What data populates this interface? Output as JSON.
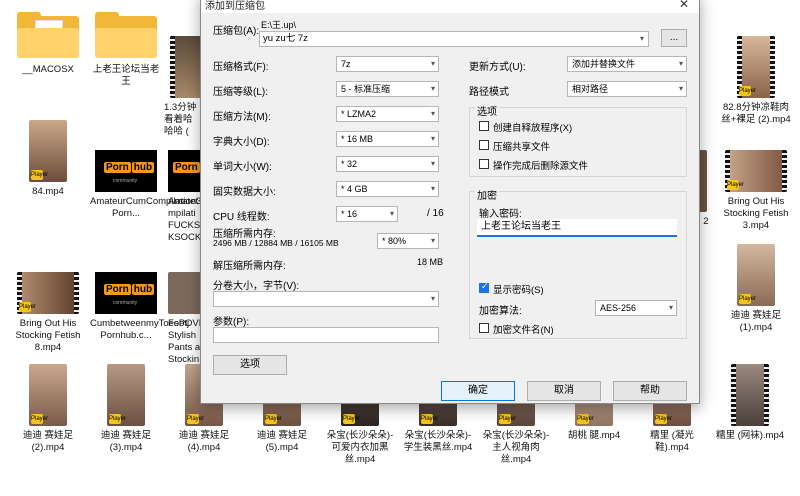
{
  "desktop": {
    "row1": [
      {
        "kind": "folder",
        "label": "__MACOSX"
      },
      {
        "kind": "folder",
        "label": "上老王论坛当老王"
      },
      {
        "kind": "video",
        "label": "1.3分钟 看着哈 哈哈 ("
      },
      {
        "kind": "video",
        "label": "82.8分钟凉鞋肉丝+裸足 (2).mp4"
      }
    ],
    "row2": [
      {
        "kind": "video",
        "label": "84.mp4"
      },
      {
        "kind": "pornhub",
        "label": "AmateurCumCompilation3MILFFEETSOCKSANDMORE-Porn..."
      },
      {
        "kind": "pornhub",
        "label": "Amatet mpilati FUCKS KSOCK"
      },
      {
        "kind": "video",
        "label": "All 2"
      },
      {
        "kind": "video",
        "label": "Bring Out His Stocking Fetish 3.mp4"
      }
    ],
    "row3": [
      {
        "kind": "video",
        "label": "Bring Out His Stocking Fetish 8.mp4"
      },
      {
        "kind": "pornhub",
        "label": "CumbetweenmyToesPOVFootjobAMATEURPORN-Pornhub.c..."
      },
      {
        "kind": "video",
        "label": "Footj Stylish Pants a Stockin"
      },
      {
        "kind": "video",
        "label": "迪迪 赛娃足 (1).mp4"
      }
    ],
    "row4": [
      {
        "kind": "video",
        "label": "迪迪 赛娃足 (2).mp4"
      },
      {
        "kind": "video",
        "label": "迪迪 赛娃足 (3).mp4"
      },
      {
        "kind": "video",
        "label": "迪迪 赛娃足 (4).mp4"
      },
      {
        "kind": "video",
        "label": "迪迪 赛娃足 (5).mp4"
      },
      {
        "kind": "video",
        "label": "朵宝(长沙朵朵)-可爱内衣加黑丝.mp4"
      },
      {
        "kind": "video",
        "label": "朵宝(长沙朵朵)-学生装黑丝.mp4"
      },
      {
        "kind": "video",
        "label": "朵宝(长沙朵朵)-主人视角肉丝.mp4"
      },
      {
        "kind": "video",
        "label": "胡桃 腿.mp4"
      },
      {
        "kind": "video",
        "label": "糯里 (凝光鞋).mp4"
      },
      {
        "kind": "video",
        "label": "糯里 (网袜).mp4"
      }
    ],
    "pornhub": {
      "logo_a": "Porn",
      "logo_b": "hub",
      "sub": "community"
    },
    "badge": "Player"
  },
  "dialog": {
    "title": "添加到压缩包",
    "archive_label": "压缩包(A):",
    "archive_path": "E:\\王.up\\",
    "archive_name": "yu zu七 7z",
    "browse_label": "...",
    "format_label": "压缩格式(F):",
    "format_value": "7z",
    "level_label": "压缩等级(L):",
    "level_value": "5 - 标准压缩",
    "method_label": "压缩方法(M):",
    "method_value": "* LZMA2",
    "dict_label": "字典大小(D):",
    "dict_value": "* 16 MB",
    "word_label": "单词大小(W):",
    "word_value": "* 32",
    "solid_label": "固实数据大小:",
    "solid_value": "* 4 GB",
    "threads_label": "CPU 线程数:",
    "threads_value": "* 16",
    "threads_max": "/ 16",
    "mem_label": "压缩所需内存:",
    "mem_value": "2496 MB / 12884 MB / 16105 MB",
    "mem_pct": "* 80%",
    "demem_label": "解压缩所需内存:",
    "demem_value": "18 MB",
    "split_label": "分卷大小，字节(V):",
    "params_label": "参数(P):",
    "options_btn": "选项",
    "update_label": "更新方式(U):",
    "update_value": "添加并替换文件",
    "path_label": "路径模式",
    "path_value": "相对路径",
    "opts_title": "选项",
    "opt_sfx": "创建自释放程序(X)",
    "opt_shared": "压缩共享文件",
    "opt_delete": "操作完成后删除源文件",
    "enc_title": "加密",
    "pwd_label": "输入密码:",
    "pwd_value": "上老王论坛当老王",
    "show_pwd": "显示密码(S)",
    "enc_method_label": "加密算法:",
    "enc_method_value": "AES-256",
    "enc_names": "加密文件名(N)",
    "ok": "确定",
    "cancel": "取消",
    "help": "帮助"
  }
}
